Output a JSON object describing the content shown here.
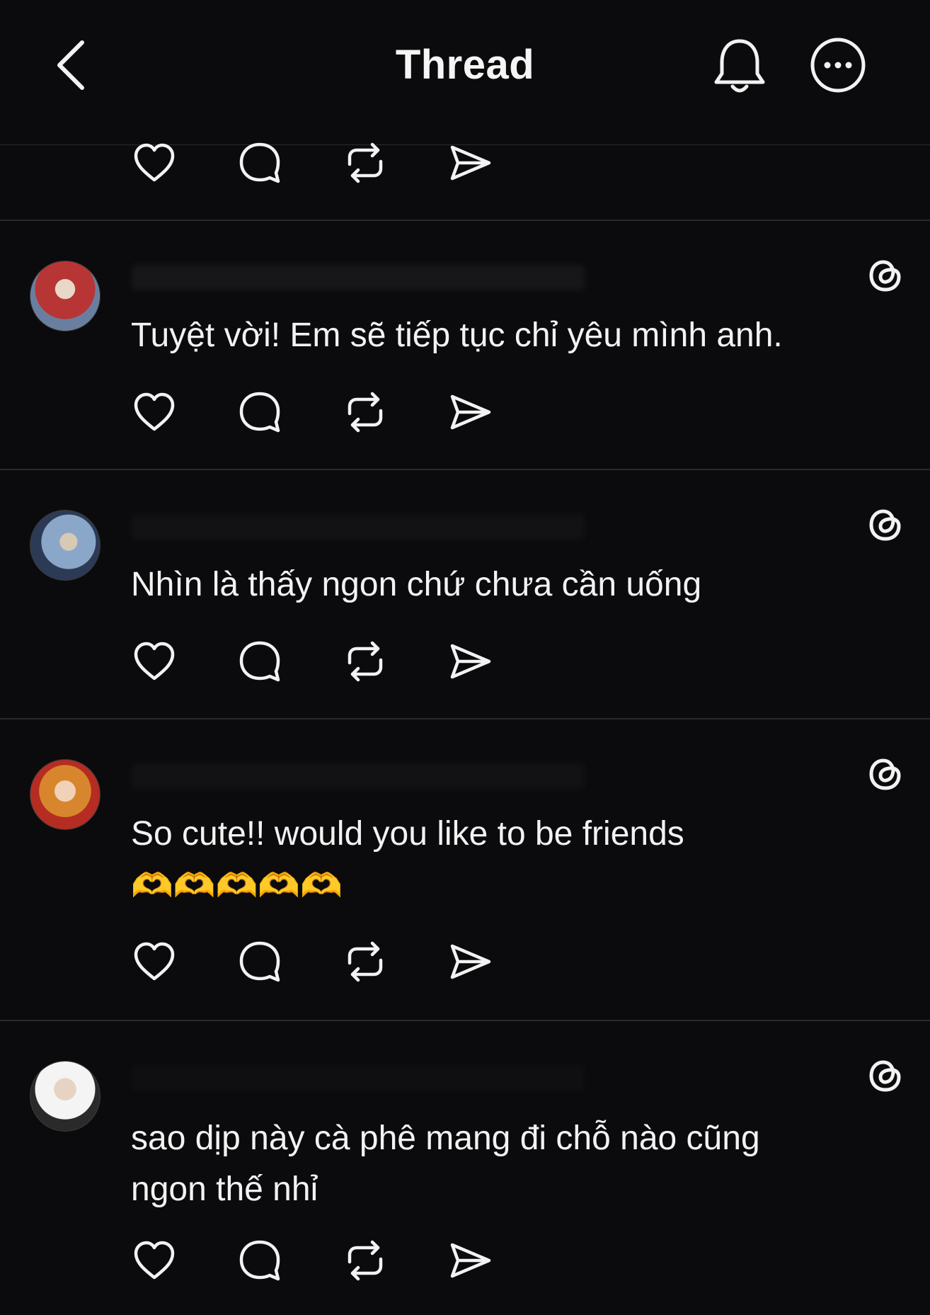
{
  "header": {
    "title": "Thread",
    "icons": {
      "back": "chevron-left-icon",
      "bell": "bell-icon",
      "more": "more-icon"
    }
  },
  "actions": [
    "heart-icon",
    "comment-icon",
    "repost-icon",
    "share-icon"
  ],
  "posts": [
    {
      "text": "Tuyệt vời! Em sẽ tiếp tục chỉ yêu mình anh.",
      "emoji": ""
    },
    {
      "text": "Nhìn là thấy ngon chứ chưa cần uống",
      "emoji": ""
    },
    {
      "text": "So cute!! would you like to be friends",
      "emoji": "🫶🫶🫶🫶🫶"
    },
    {
      "text": "sao dịp này cà phê mang đi chỗ nào cũng ngon thế nhỉ",
      "emoji": ""
    }
  ],
  "colors": {
    "background": "#0b0b0d",
    "text": "#f2f2f2",
    "divider": "#2a2a2c"
  }
}
